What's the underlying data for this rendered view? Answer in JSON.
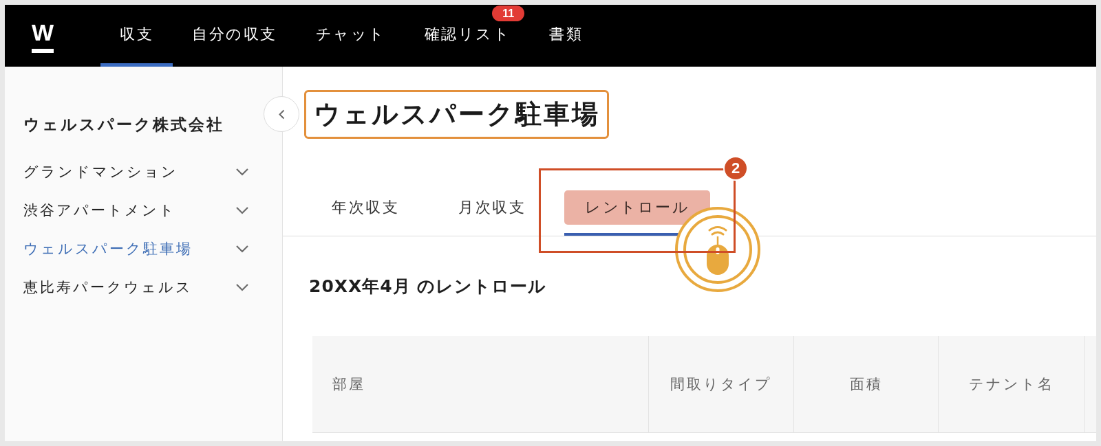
{
  "nav": {
    "logo": "W",
    "items": [
      {
        "label": "収支",
        "selected": true
      },
      {
        "label": "自分の収支",
        "selected": false
      },
      {
        "label": "チャット",
        "selected": false
      },
      {
        "label": "確認リスト",
        "selected": false,
        "badge": "11"
      },
      {
        "label": "書類",
        "selected": false
      }
    ]
  },
  "sidebar": {
    "company": "ウェルスパーク株式会社",
    "items": [
      {
        "label": "グランドマンション",
        "selected": false,
        "expanded": false
      },
      {
        "label": "渋谷アパートメント",
        "selected": false,
        "expanded": false
      },
      {
        "label": "ウェルスパーク駐車場",
        "selected": true,
        "expanded": false
      },
      {
        "label": "恵比寿パークウェルス",
        "selected": false,
        "expanded": false
      }
    ]
  },
  "page": {
    "title": "ウェルスパーク駐車場",
    "title_highlighted": true
  },
  "tabs": [
    {
      "label": "年次収支",
      "selected": false,
      "highlighted": false
    },
    {
      "label": "月次収支",
      "selected": false,
      "highlighted": false
    },
    {
      "label": "レントロール",
      "selected": true,
      "highlighted": true
    }
  ],
  "callout": {
    "number": "2"
  },
  "section_title": "20XX年4月 のレントロール",
  "table": {
    "columns": [
      "部屋",
      "間取りタイプ",
      "面積",
      "テナント名"
    ]
  }
}
